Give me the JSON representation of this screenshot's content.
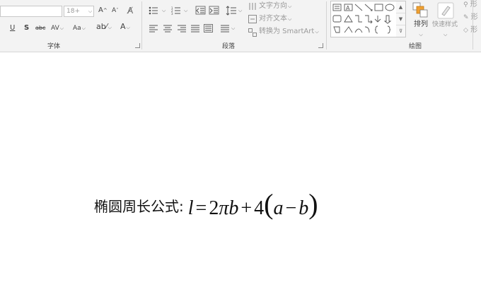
{
  "ribbon": {
    "font_group": {
      "label": "字体",
      "font_size_value": "18+",
      "underline": "U",
      "shadow": "S",
      "strikethrough": "abc",
      "char_spacing": "AV",
      "font_color": "A"
    },
    "paragraph_group": {
      "label": "段落",
      "text_direction": "文字方向",
      "align_text": "对齐文本",
      "convert_smartart": "转换为 SmartArt"
    },
    "drawing_group": {
      "label": "绘图",
      "arrange": "排列",
      "quick_styles": "快速样式",
      "shape_fill": "形",
      "shape_outline": "形",
      "shape_effects": "形"
    }
  },
  "document": {
    "label": "椭圆周长公式:",
    "formula": {
      "lhs": "l",
      "equals": "=",
      "coef1": "2",
      "pi": "π",
      "var_b1": "b",
      "plus": "+",
      "coef2": "4",
      "open_paren": "(",
      "var_a": "a",
      "minus": "−",
      "var_b2": "b",
      "close_paren": ")"
    }
  }
}
